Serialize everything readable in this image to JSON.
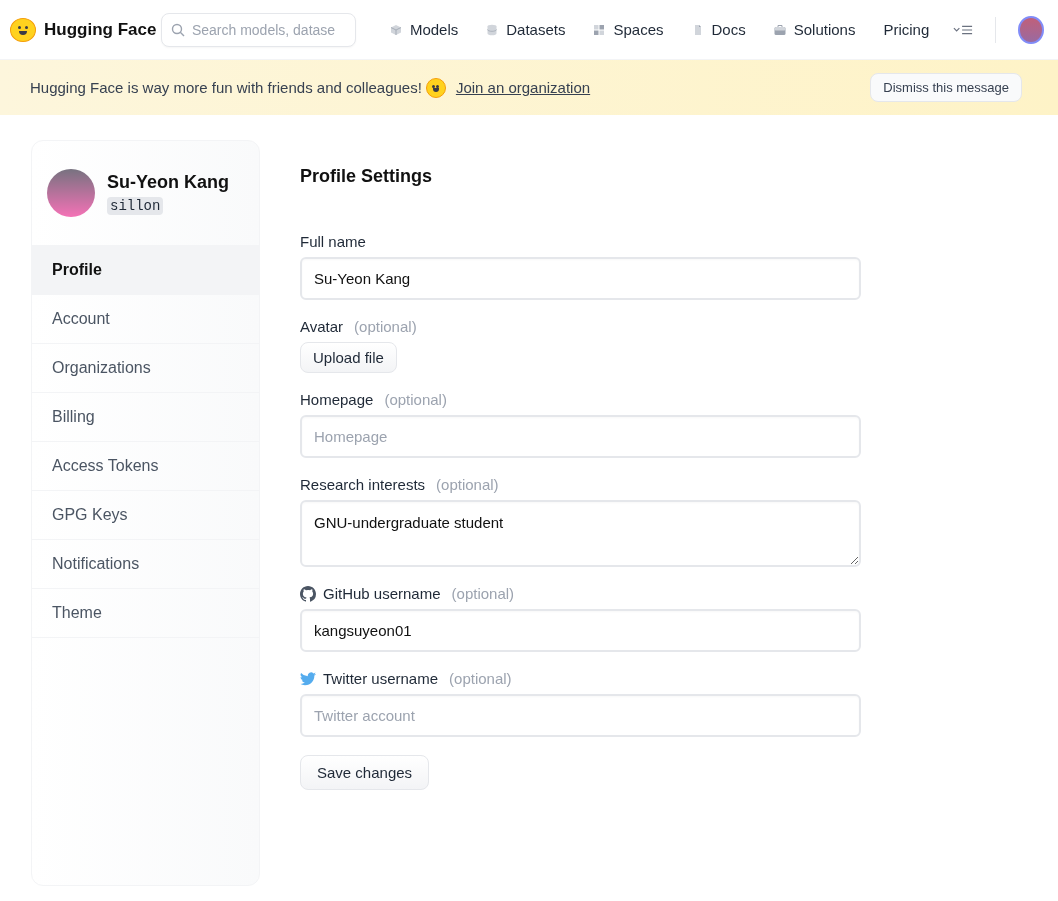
{
  "header": {
    "brand": "Hugging Face",
    "search": {
      "placeholder": "Search models, datase"
    },
    "nav": [
      {
        "label": "Models"
      },
      {
        "label": "Datasets"
      },
      {
        "label": "Spaces"
      },
      {
        "label": "Docs"
      },
      {
        "label": "Solutions"
      },
      {
        "label": "Pricing"
      }
    ]
  },
  "banner": {
    "message": "Hugging Face is way more fun with friends and colleagues!",
    "link": "Join an organization",
    "dismiss": "Dismiss this message"
  },
  "sidebar": {
    "name": "Su-Yeon Kang",
    "username": "sillon",
    "items": [
      {
        "label": "Profile",
        "selected": true
      },
      {
        "label": "Account",
        "selected": false
      },
      {
        "label": "Organizations",
        "selected": false
      },
      {
        "label": "Billing",
        "selected": false
      },
      {
        "label": "Access Tokens",
        "selected": false
      },
      {
        "label": "GPG Keys",
        "selected": false
      },
      {
        "label": "Notifications",
        "selected": false
      },
      {
        "label": "Theme",
        "selected": false
      }
    ]
  },
  "form": {
    "title": "Profile Settings",
    "fields": [
      {
        "kind": "text",
        "label": "Full name",
        "value": "Su-Yeon Kang"
      },
      {
        "kind": "file",
        "label": "Avatar",
        "optional": "(optional)",
        "button": "Upload file"
      },
      {
        "kind": "text",
        "label": "Homepage",
        "optional": "(optional)",
        "placeholder": "Homepage"
      },
      {
        "kind": "textarea",
        "label": "Research interests",
        "optional": "(optional)",
        "value": "GNU-undergraduate student"
      },
      {
        "kind": "github",
        "label": "GitHub username",
        "optional": "(optional)",
        "value": "kangsuyeon01"
      },
      {
        "kind": "twitter",
        "label": "Twitter username",
        "optional": "(optional)",
        "placeholder": "Twitter account"
      }
    ],
    "save": "Save changes"
  }
}
